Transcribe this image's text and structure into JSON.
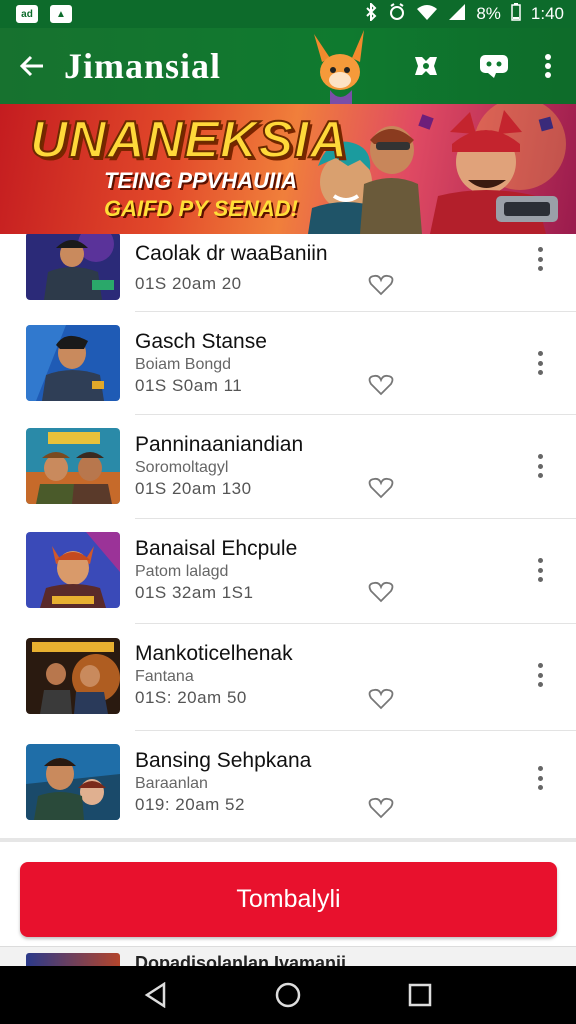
{
  "status_bar": {
    "left_icons": [
      "notification-app-icon",
      "notification-app-icon"
    ],
    "right_icons": [
      "bluetooth-icon",
      "alarm-icon",
      "wifi-icon",
      "signal-icon",
      "battery-icon"
    ],
    "battery": "8%",
    "time": "1:40"
  },
  "app_bar": {
    "title": "Jimansial",
    "back_icon": "arrow-left-icon",
    "actions": [
      "cast-icon",
      "chat-icon",
      "more-vertical-icon"
    ]
  },
  "banner": {
    "title": "UNANEKSIA",
    "line1": "TEING PPVHAUIIA",
    "line2": "GAIFD PY SENAD!"
  },
  "list": {
    "items": [
      {
        "title": "Caolak dr waaBaniin",
        "subtitle": "",
        "meta": "01S 20am 20"
      },
      {
        "title": "Gasch Stanse",
        "subtitle": "Boiam Bongd",
        "meta": "01S S0am 11"
      },
      {
        "title": "Panninaaniandian",
        "subtitle": "Soromoltagyl",
        "meta": "01S 20am 130"
      },
      {
        "title": "Banaisal Ehcpule",
        "subtitle": "Patom lalagd",
        "meta": "01S 32am 1S1"
      },
      {
        "title": "Mankoticelhenak",
        "subtitle": "Fantana",
        "meta": "01S: 20am 50"
      },
      {
        "title": "Bansing Sehpkana",
        "subtitle": "Baraanlan",
        "meta": "019: 20am 52"
      }
    ],
    "peek_title": "Dopadisolanlan Ivamanii"
  },
  "cta": {
    "label": "Tombalyli"
  },
  "colors": {
    "primary_green": "#0f7a2f",
    "cta_red": "#e8112d"
  }
}
